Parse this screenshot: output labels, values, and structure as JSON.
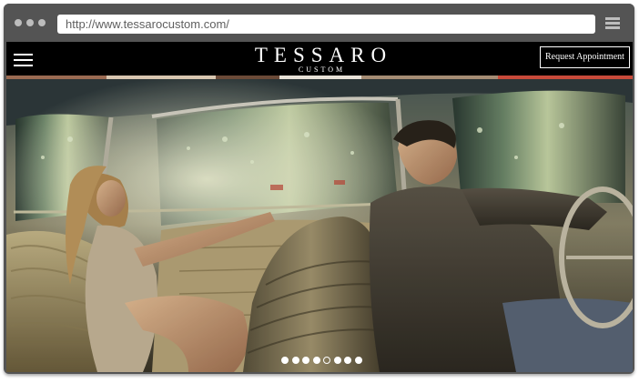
{
  "browser": {
    "url": "http://www.tessarocustom.com/",
    "menu_icon": "hamburger-menu-icon",
    "window_dots": [
      "dot-1",
      "dot-2",
      "dot-3"
    ]
  },
  "site": {
    "logo_main": "TESSARO",
    "logo_sub": "CUSTOM",
    "menu_icon": "hamburger-menu-icon",
    "cta_label": "Request Appointment"
  },
  "slider": {
    "total_slides": 8,
    "active_index": 4
  },
  "colors": {
    "frame": "#545454",
    "header_bg": "#000000",
    "text_light": "#ffffff",
    "address_text": "#5f5f5f"
  }
}
